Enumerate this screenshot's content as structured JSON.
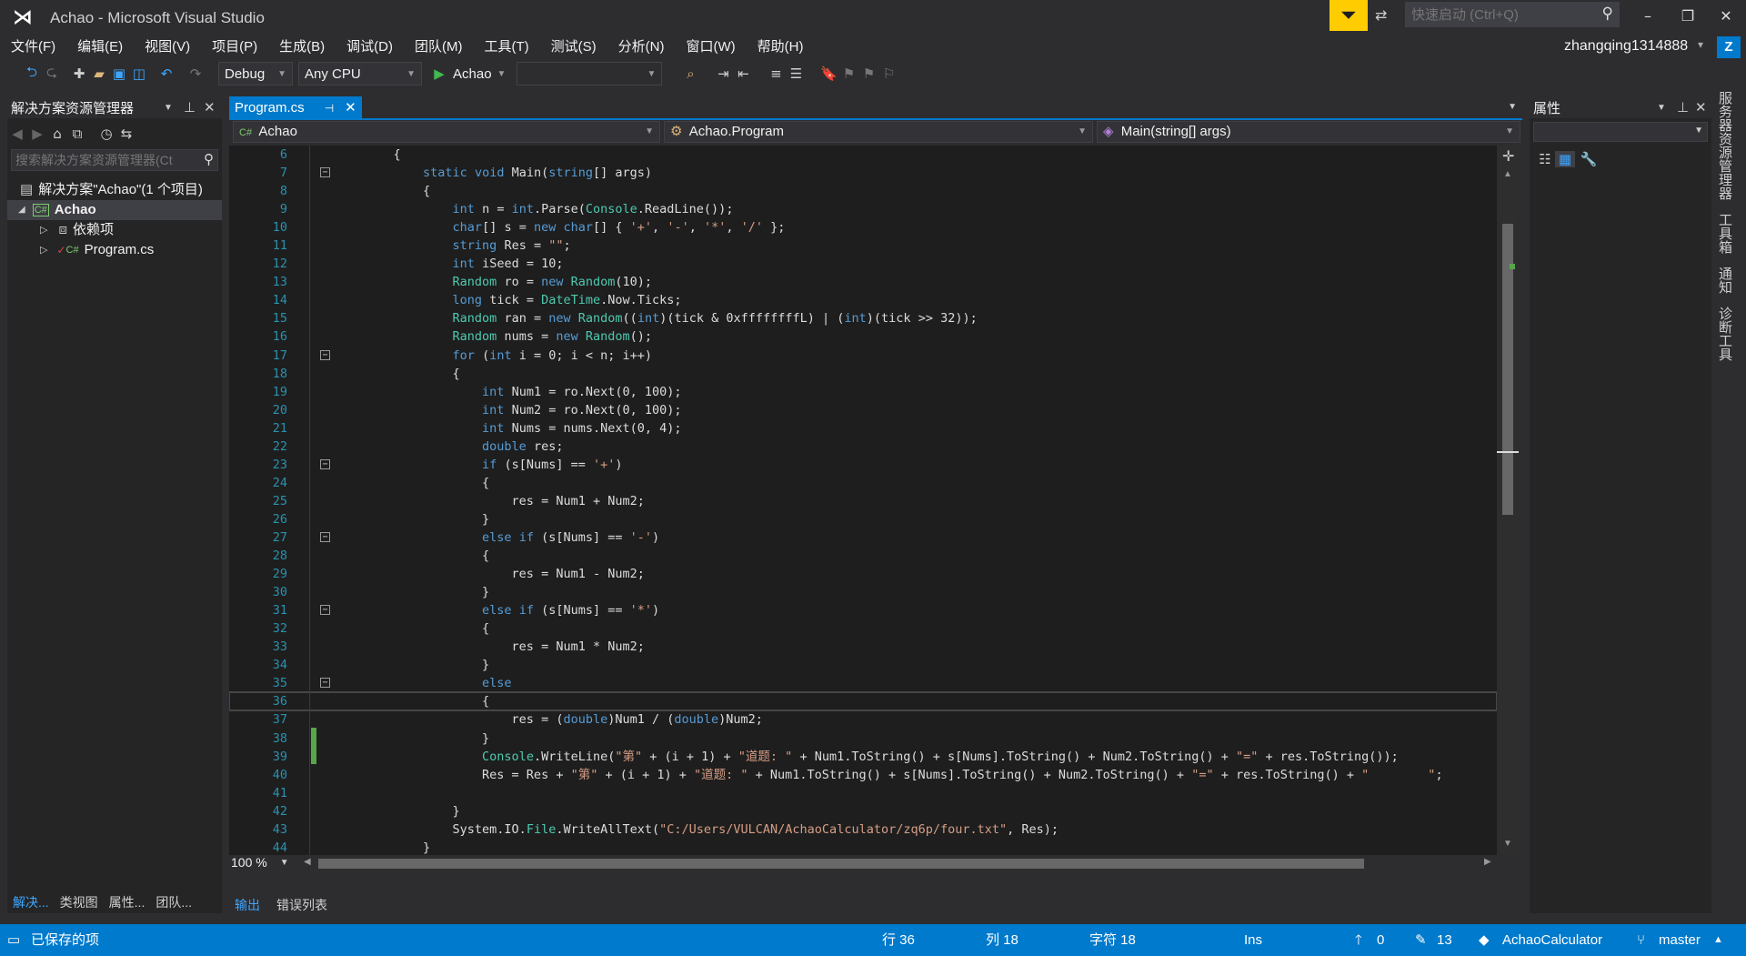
{
  "window": {
    "title": "Achao - Microsoft Visual Studio",
    "quick_launch_placeholder": "快速启动 (Ctrl+Q)",
    "user_name": "zhangqing1314888",
    "user_initial": "Z"
  },
  "menu": [
    "文件(F)",
    "编辑(E)",
    "视图(V)",
    "项目(P)",
    "生成(B)",
    "调试(D)",
    "团队(M)",
    "工具(T)",
    "测试(S)",
    "分析(N)",
    "窗口(W)",
    "帮助(H)"
  ],
  "toolbar": {
    "configuration": "Debug",
    "platform": "Any CPU",
    "start_label": "Achao",
    "target": ""
  },
  "solution_explorer": {
    "title": "解决方案资源管理器",
    "search_placeholder": "搜索解决方案资源管理器(Ct",
    "tree": [
      {
        "label": "解决方案\"Achao\"(1 个项目)",
        "icon": "solution-icon"
      },
      {
        "label": "Achao",
        "icon": "csharp-project-icon"
      },
      {
        "label": "依赖项",
        "icon": "dependencies-icon"
      },
      {
        "label": "Program.cs",
        "icon": "csharp-file-icon"
      }
    ],
    "bottom_tabs": [
      "解决...",
      "类视图",
      "属性...",
      "团队..."
    ]
  },
  "editor": {
    "tab": "Program.cs",
    "nav_project": "Achao",
    "nav_class": "Achao.Program",
    "nav_member": "Main(string[] args)",
    "zoom": "100 %",
    "lines": [
      {
        "n": "6",
        "text": "    {"
      },
      {
        "n": "7",
        "text": "        static void Main(string[] args)"
      },
      {
        "n": "8",
        "text": "        {"
      },
      {
        "n": "9",
        "text": "            int n = int.Parse(Console.ReadLine());"
      },
      {
        "n": "10",
        "text": "            char[] s = new char[] { '+', '-', '*', '/' };"
      },
      {
        "n": "11",
        "text": "            string Res = \"\";"
      },
      {
        "n": "12",
        "text": "            int iSeed = 10;"
      },
      {
        "n": "13",
        "text": "            Random ro = new Random(10);"
      },
      {
        "n": "14",
        "text": "            long tick = DateTime.Now.Ticks;"
      },
      {
        "n": "15",
        "text": "            Random ran = new Random((int)(tick & 0xffffffffL) | (int)(tick >> 32));"
      },
      {
        "n": "16",
        "text": "            Random nums = new Random();"
      },
      {
        "n": "17",
        "text": "            for (int i = 0; i < n; i++)"
      },
      {
        "n": "18",
        "text": "            {"
      },
      {
        "n": "19",
        "text": "                int Num1 = ro.Next(0, 100);"
      },
      {
        "n": "20",
        "text": "                int Num2 = ro.Next(0, 100);"
      },
      {
        "n": "21",
        "text": "                int Nums = nums.Next(0, 4);"
      },
      {
        "n": "22",
        "text": "                double res;"
      },
      {
        "n": "23",
        "text": "                if (s[Nums] == '+')"
      },
      {
        "n": "24",
        "text": "                {"
      },
      {
        "n": "25",
        "text": "                    res = Num1 + Num2;"
      },
      {
        "n": "26",
        "text": "                }"
      },
      {
        "n": "27",
        "text": "                else if (s[Nums] == '-')"
      },
      {
        "n": "28",
        "text": "                {"
      },
      {
        "n": "29",
        "text": "                    res = Num1 - Num2;"
      },
      {
        "n": "30",
        "text": "                }"
      },
      {
        "n": "31",
        "text": "                else if (s[Nums] == '*')"
      },
      {
        "n": "32",
        "text": "                {"
      },
      {
        "n": "33",
        "text": "                    res = Num1 * Num2;"
      },
      {
        "n": "34",
        "text": "                }"
      },
      {
        "n": "35",
        "text": "                else"
      },
      {
        "n": "36",
        "text": "                {"
      },
      {
        "n": "37",
        "text": "                    res = (double)Num1 / (double)Num2;"
      },
      {
        "n": "38",
        "text": "                }"
      },
      {
        "n": "39",
        "text": "                Console.WriteLine(\"第\" + (i + 1) + \"道题: \" + Num1.ToString() + s[Nums].ToString() + Num2.ToString() + \"=\" + res.ToString());"
      },
      {
        "n": "40",
        "text": "                Res = Res + \"第\" + (i + 1) + \"道题: \" + Num1.ToString() + s[Nums].ToString() + Num2.ToString() + \"=\" + res.ToString() + \"        \";"
      },
      {
        "n": "41",
        "text": ""
      },
      {
        "n": "42",
        "text": "            }"
      },
      {
        "n": "43",
        "text": "            System.IO.File.WriteAllText(\"C:/Users/VULCAN/AchaoCalculator/zq6p/four.txt\", Res);"
      },
      {
        "n": "44",
        "text": "        }"
      }
    ]
  },
  "output": {
    "tabs": [
      "输出",
      "错误列表"
    ]
  },
  "properties": {
    "title": "属性"
  },
  "right_rail": [
    "服务器资源管理器",
    "工具箱",
    "通知",
    "诊断工具"
  ],
  "status": {
    "message": "已保存的项",
    "line": "行 36",
    "col": "列 18",
    "char": "字符 18",
    "mode": "Ins",
    "up_count": "0",
    "pencil_count": "13",
    "repo": "AchaoCalculator",
    "branch": "master"
  },
  "colors": {
    "accent": "#007acc",
    "notification": "#ffcc00",
    "editor_bg": "#1e1e1e",
    "chrome_bg": "#2d2d30"
  }
}
